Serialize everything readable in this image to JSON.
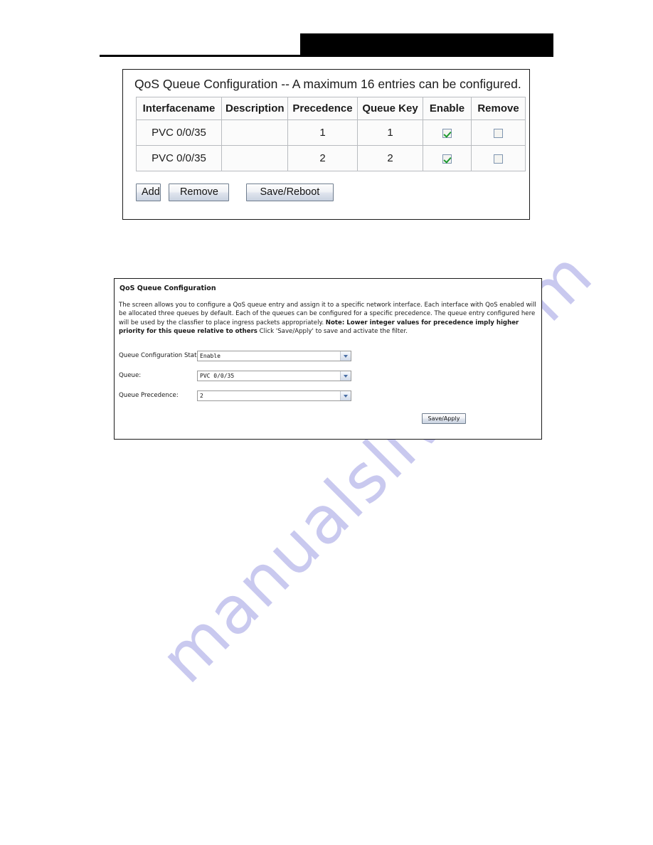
{
  "header": {
    "redaction_bar": "",
    "rule": ""
  },
  "watermark": {
    "text": "manualslive.com"
  },
  "queue_list_panel": {
    "title": "QoS Queue Configuration -- A maximum 16 entries can be configured.",
    "table": {
      "columns": [
        "Interfacename",
        "Description",
        "Precedence",
        "Queue Key",
        "Enable",
        "Remove"
      ],
      "rows": [
        {
          "interfacename": "PVC 0/0/35",
          "description": "",
          "precedence": "1",
          "queue_key": "1",
          "enable_checked": true,
          "remove_checked": false
        },
        {
          "interfacename": "PVC 0/0/35",
          "description": "",
          "precedence": "2",
          "queue_key": "2",
          "enable_checked": true,
          "remove_checked": false
        }
      ]
    },
    "buttons": {
      "add": "Add",
      "remove": "Remove",
      "save_reboot": "Save/Reboot"
    }
  },
  "queue_form_panel": {
    "title": "QoS Queue Configuration",
    "description_part1": "The screen allows you to configure a QoS queue entry and assign it to a specific network interface. Each interface with QoS enabled will be allocated three queues by default. Each of the queues can be configured for a specific precedence. The queue entry configured here will be used by the classfier to place ingress packets appropriately. ",
    "description_bold": "Note: Lower integer values for precedence imply higher priority for this queue relative to others",
    "description_part2": " Click 'Save/Apply' to save and activate the filter.",
    "fields": [
      {
        "label": "Queue Configuration Status:",
        "value": "Enable"
      },
      {
        "label": "Queue:",
        "value": "PVC 0/0/35"
      },
      {
        "label": "Queue Precedence:",
        "value": "2"
      }
    ],
    "save_apply_label": "Save/Apply"
  }
}
